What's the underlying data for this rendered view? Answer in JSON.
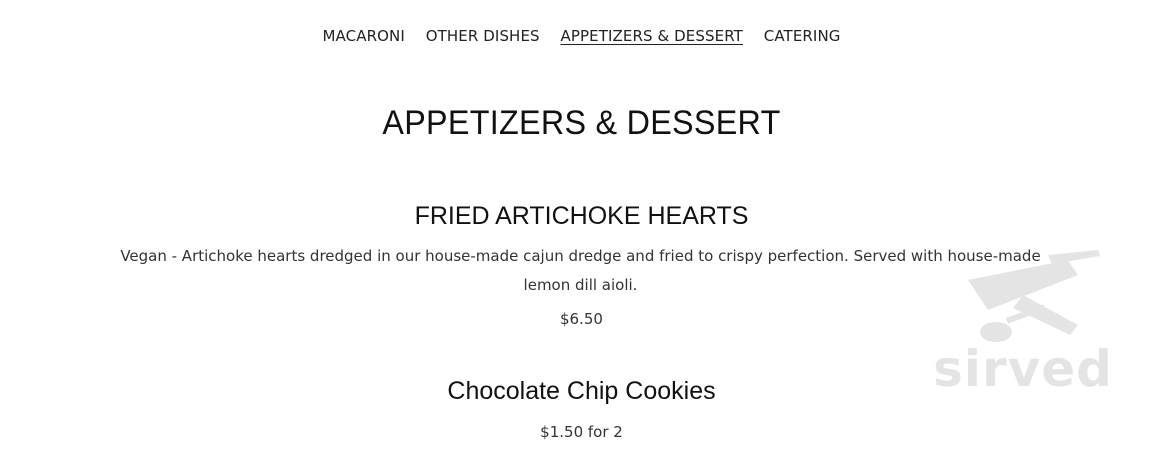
{
  "nav": {
    "items": [
      {
        "label": "MACARONI"
      },
      {
        "label": "OTHER DISHES"
      },
      {
        "label": "APPETIZERS & DESSERT",
        "active": true
      },
      {
        "label": "CATERING"
      }
    ]
  },
  "page": {
    "title": "APPETIZERS & DESSERT"
  },
  "menu_items": [
    {
      "name": "FRIED ARTICHOKE HEARTS",
      "description": "Vegan - Artichoke hearts dredged in our house-made cajun dredge and fried to crispy perfection. Served with house-made lemon dill aioli.",
      "price": "$6.50"
    },
    {
      "name": "Chocolate Chip Cookies",
      "price": "$1.50 for 2"
    }
  ],
  "watermark": {
    "text": "sirved",
    "icon": "utensils-icon"
  }
}
